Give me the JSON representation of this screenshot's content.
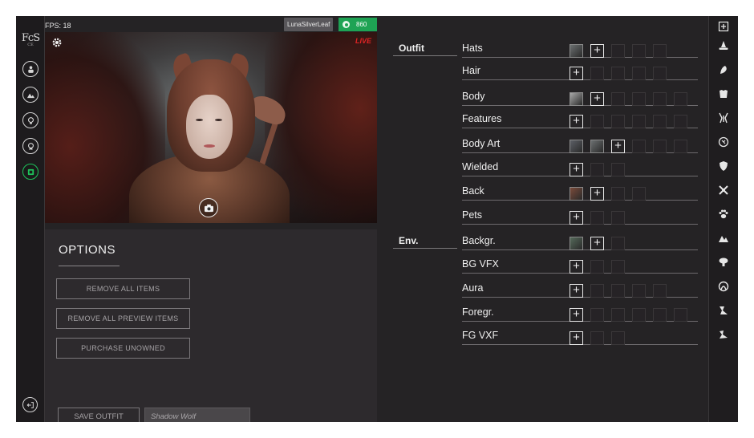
{
  "topbar": {
    "fps": "FPS: 18",
    "username": "LunaSilverLeaf",
    "currency": "860"
  },
  "logo": {
    "text": "FcS",
    "sub": "CE"
  },
  "preview": {
    "live_badge": "LIVE"
  },
  "options": {
    "title": "OPTIONS",
    "remove_all": "REMOVE ALL ITEMS",
    "remove_preview": "REMOVE ALL PREVIEW ITEMS",
    "purchase": "PURCHASE UNOWNED",
    "save_outfit": "SAVE OUTFIT",
    "outfit_name_placeholder": "Shadow Wolf"
  },
  "groups": {
    "outfit": "Outfit",
    "env": "Env."
  },
  "categories": [
    {
      "label": "Hats",
      "slots": [
        "thumb",
        "add",
        "empty",
        "empty",
        "empty"
      ]
    },
    {
      "label": "Hair",
      "slots": [
        "add",
        "empty",
        "empty",
        "empty",
        "empty"
      ]
    },
    {
      "label": "Body",
      "slots": [
        "thumb",
        "add",
        "empty",
        "empty",
        "empty",
        "empty"
      ]
    },
    {
      "label": "Features",
      "slots": [
        "add",
        "empty",
        "empty",
        "empty",
        "empty",
        "empty"
      ]
    },
    {
      "label": "Body Art",
      "slots": [
        "thumb",
        "thumb",
        "add",
        "empty",
        "empty",
        "empty"
      ]
    },
    {
      "label": "Wielded",
      "slots": [
        "add",
        "empty",
        "empty"
      ]
    },
    {
      "label": "Back",
      "slots": [
        "thumb",
        "add",
        "empty",
        "empty"
      ]
    },
    {
      "label": "Pets",
      "slots": [
        "add",
        "empty",
        "empty"
      ]
    },
    {
      "label": "Backgr.",
      "slots": [
        "thumb",
        "add",
        "empty"
      ]
    },
    {
      "label": "BG VFX",
      "slots": [
        "add",
        "empty",
        "empty"
      ]
    },
    {
      "label": "Aura",
      "slots": [
        "add",
        "empty",
        "empty",
        "empty",
        "empty"
      ]
    },
    {
      "label": "Foregr.",
      "slots": [
        "add",
        "empty",
        "empty",
        "empty",
        "empty",
        "empty"
      ]
    },
    {
      "label": "FG VXF",
      "slots": [
        "add",
        "empty",
        "empty"
      ]
    }
  ],
  "icons": {
    "left_rail": [
      "character-icon",
      "landscape-icon",
      "lightbulb-icon",
      "badge-icon",
      "inventory-icon"
    ],
    "right_rail": [
      "add-icon",
      "hat-icon",
      "hair-icon",
      "body-icon",
      "features-icon",
      "body-art-icon",
      "shield-icon",
      "wielded-icon",
      "pet-paw-icon",
      "background-icon",
      "vfx-icon",
      "aura-icon",
      "foreground-icon",
      "fg-vfx-icon"
    ]
  },
  "colors": {
    "accent_green": "#1ea354",
    "live_red": "#e02424",
    "panel_bg": "#252325"
  }
}
